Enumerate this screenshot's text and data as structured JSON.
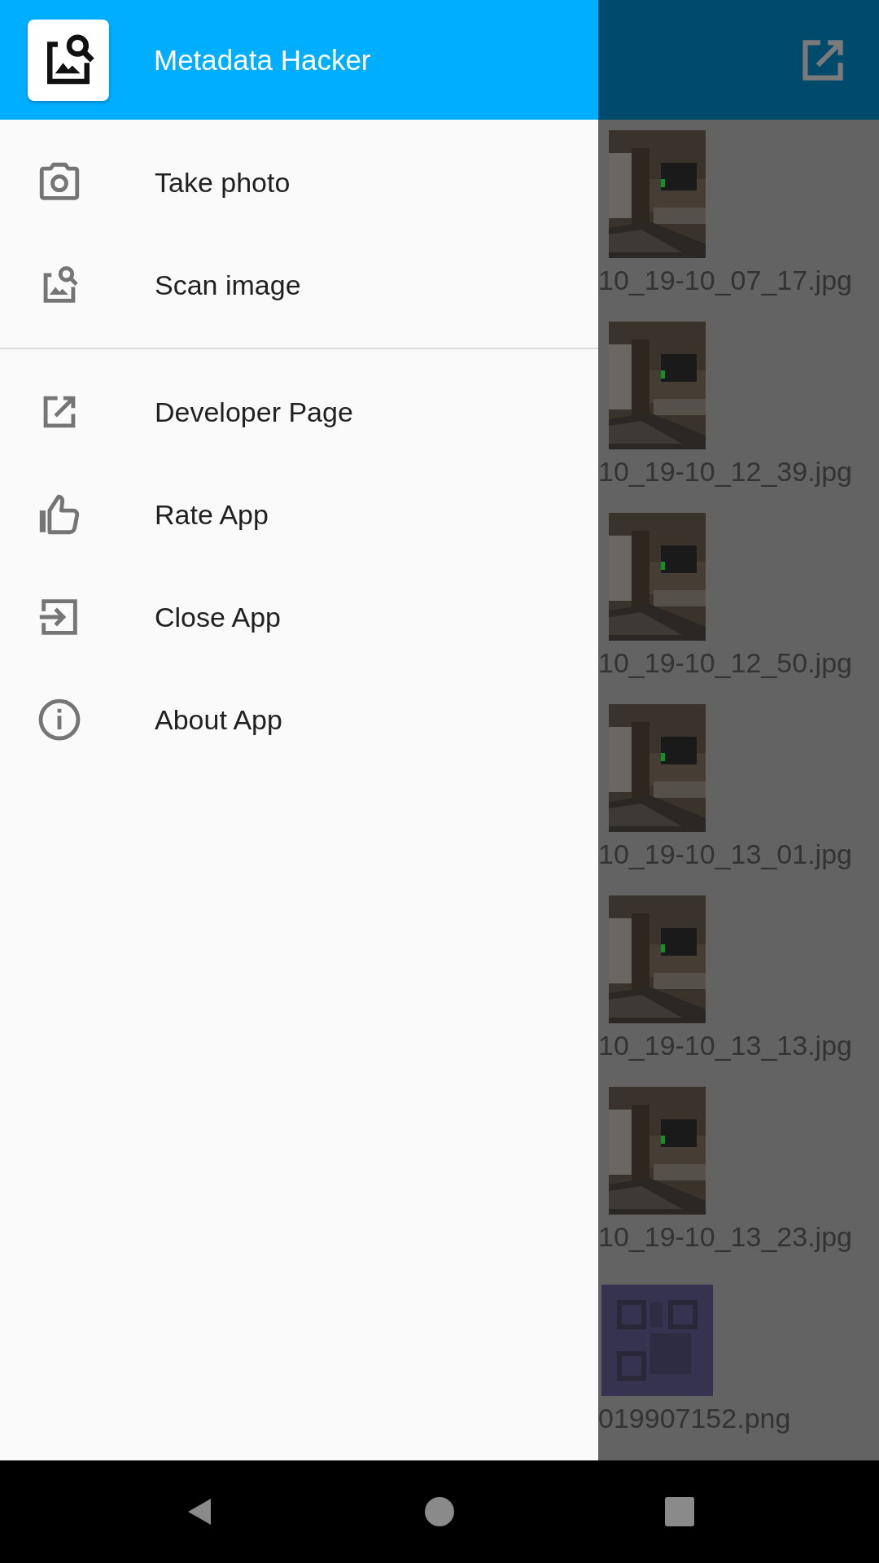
{
  "drawer": {
    "title": "Metadata Hacker",
    "sections": [
      {
        "items": [
          {
            "label": "Take photo"
          },
          {
            "label": "Scan image"
          }
        ]
      },
      {
        "items": [
          {
            "label": "Developer Page"
          },
          {
            "label": "Rate App"
          },
          {
            "label": "Close App"
          },
          {
            "label": "About App"
          }
        ]
      }
    ]
  },
  "files": [
    "10_19-10_07_17.jpg",
    "10_19-10_12_39.jpg",
    "10_19-10_12_50.jpg",
    "10_19-10_13_01.jpg",
    "10_19-10_13_13.jpg",
    "10_19-10_13_23.jpg",
    "019907152.png"
  ]
}
